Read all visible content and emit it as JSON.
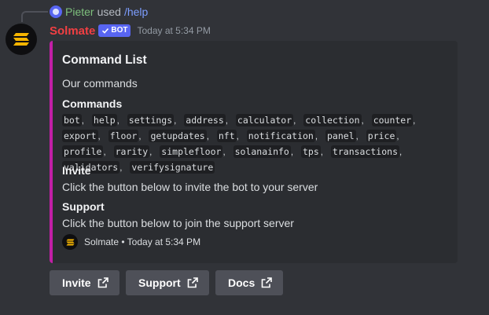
{
  "reply": {
    "user": "Pieter",
    "used": "used",
    "command": "/help"
  },
  "message": {
    "author": "Solmate",
    "badge": "BOT",
    "timestamp": "Today at 5:34 PM"
  },
  "embed": {
    "accent": "#c21fa6",
    "title": "Command List",
    "description": "Our commands",
    "fields": {
      "commands": {
        "name": "Commands",
        "items": [
          "bot",
          "help",
          "settings",
          "address",
          "calculator",
          "collection",
          "counter",
          "export",
          "floor",
          "getupdates",
          "nft",
          "notification",
          "panel",
          "price",
          "profile",
          "rarity",
          "simplefloor",
          "solanainfo",
          "tps",
          "transactions",
          "validators",
          "verifysignature"
        ]
      },
      "invite": {
        "name": "Invite",
        "value": "Click the button below to invite the bot to your server"
      },
      "support": {
        "name": "Support",
        "value": "Click the button below to join the support server"
      }
    },
    "footer": {
      "text": "Solmate • Today at 5:34 PM"
    }
  },
  "buttons": {
    "invite": "Invite",
    "support": "Support",
    "docs": "Docs"
  },
  "colors": {
    "background": "#313338",
    "embed_bg": "#2b2d31",
    "username": "#f23f43",
    "badge": "#5865f2",
    "button": "#4e5058",
    "link": "#7d9eff",
    "reply_user": "#7ec07d"
  },
  "icons": {
    "avatar": "solana-logo-icon",
    "external": "external-link-icon",
    "verified": "checkmark-icon"
  }
}
